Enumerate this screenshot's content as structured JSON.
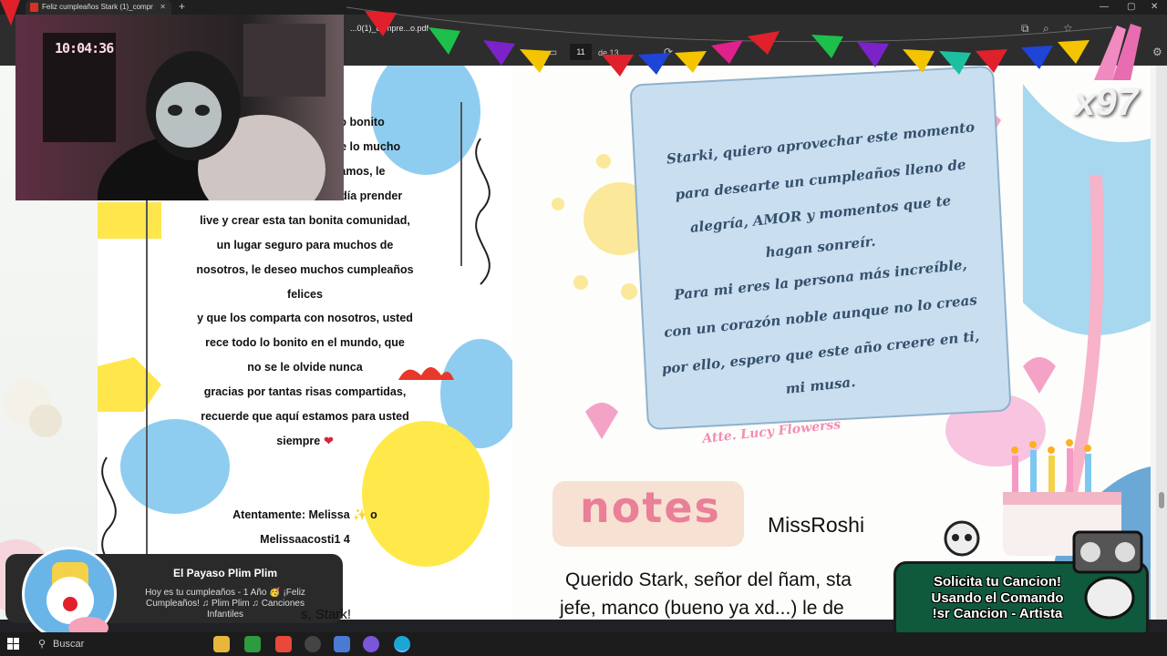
{
  "browser": {
    "tab_title": "Feliz cumpleaños Stark (1)_compr",
    "pdf_title": "...0(1)_compre...o.pdf",
    "page_current": "11",
    "page_total": "de 13"
  },
  "webcam": {
    "clock": "10:04:36"
  },
  "page1": {
    "lines": [
      "xio bonito",
      "ole lo mucho",
      "ciamos, le",
      "n día prender",
      "live y crear esta tan bonita comunidad,",
      "un lugar seguro para muchos de",
      "nosotros, le deseo muchos cumpleaños",
      "felices",
      "y que los comparta con nosotros, usted",
      "rece todo lo bonito en el mundo, que",
      "no se le olvide nunca",
      "gracias por tantas risas compartidas,",
      "recuerde que aquí estamos para usted",
      "siempre"
    ],
    "signature_1": "Atentamente: Melissa",
    "signature_2": "Melissaacosti1 4",
    "heart": "❤"
  },
  "page2": {
    "card_lines": [
      "Starki, quiero aprovechar este momento",
      "para desearte un cumpleaños lleno de",
      "alegría, AMOR y momentos que te",
      "hagan sonreír.",
      "Para mi eres la persona más increíble,",
      "con un corazón noble aunque no lo creas",
      "por ello, espero que este año creere en ti,",
      "mi musa."
    ],
    "sign": "Atte. Lucy Flowerss",
    "notes_title": "notes",
    "author": "MissRoshi",
    "body_1": "Querido Stark, señor del ñam, sta",
    "body_2": "jefe, manco (bueno ya xd...) le de"
  },
  "overlay": {
    "multiplier": "x97",
    "song_lines": [
      "Solicita tu Cancion!",
      "Usando el Comando",
      "!sr Cancion - Artista"
    ]
  },
  "notification": {
    "title": "El Payaso Plim Plim",
    "body": "Hoy es tu cumpleaños - 1 Año 🥳 ¡Feliz Cumpleaños! ♫ Plim Plim ♫ Canciones Infantiles",
    "partial": "s, Stark!"
  },
  "taskbar": {
    "search_label": "Buscar"
  },
  "colors": {
    "accent_green": "#0f5a3c",
    "card_blue": "#c9dff0",
    "notes_pink": "#ea7f98"
  }
}
